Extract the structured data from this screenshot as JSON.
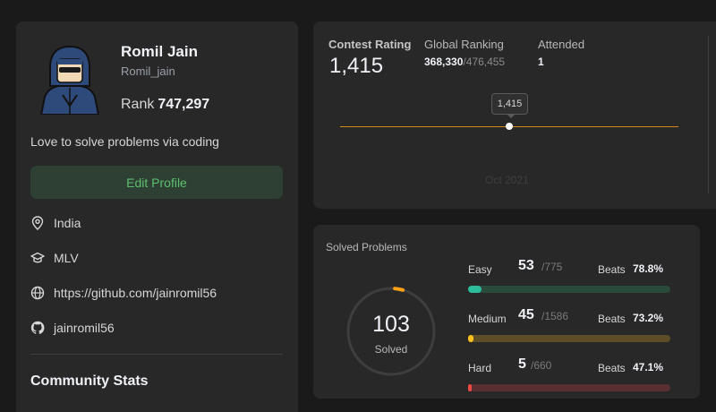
{
  "profile": {
    "name": "Romil Jain",
    "handle": "Romil_jain",
    "rank_label": "Rank",
    "rank_value": "747,297",
    "bio": "Love to solve problems via coding",
    "edit_button": "Edit Profile",
    "location": "India",
    "school": "MLV",
    "website": "https://github.com/jainromil56",
    "github": "jainromil56",
    "community_title": "Community Stats"
  },
  "contest": {
    "rating_label": "Contest Rating",
    "rating_value": "1,415",
    "global_label": "Global Ranking",
    "global_rank": "368,330",
    "global_total": "/476,455",
    "attended_label": "Attended",
    "attended_value": "1",
    "tooltip": "1,415",
    "date": "Oct 2021"
  },
  "solved": {
    "title": "Solved Problems",
    "count": "103",
    "count_label": "Solved",
    "beats_label": "Beats",
    "difficulties": [
      {
        "name": "Easy",
        "solved": "53",
        "total": "/775",
        "beats": "78.8%",
        "fraction": 0.0684,
        "fill_color": "#2cbb9b",
        "track_color": "#2a4a3b"
      },
      {
        "name": "Medium",
        "solved": "45",
        "total": "/1586",
        "beats": "73.2%",
        "fraction": 0.0284,
        "fill_color": "#ffc01e",
        "track_color": "#5e4e28"
      },
      {
        "name": "Hard",
        "solved": "5",
        "total": "/660",
        "beats": "47.1%",
        "fraction": 0.0076,
        "fill_color": "#ef4743",
        "track_color": "#5a2f31"
      }
    ]
  },
  "colors": {
    "accent": "#ffa116",
    "green": "#5cc06e"
  }
}
